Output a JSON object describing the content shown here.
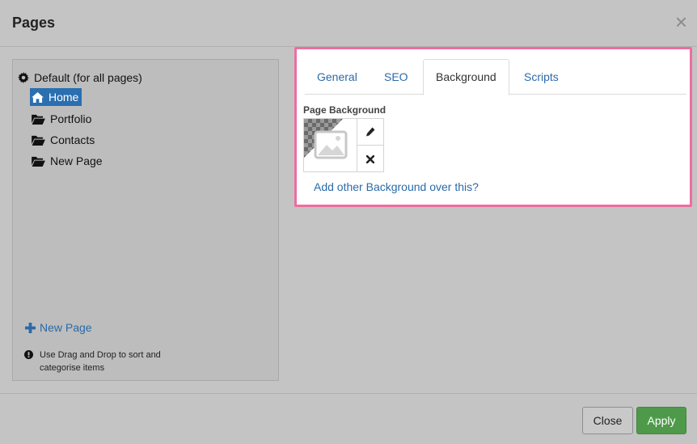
{
  "modal": {
    "title": "Pages",
    "close_icon": "close-icon"
  },
  "tree": {
    "root_label": "Default (for all pages)",
    "items": [
      {
        "label": "Home",
        "icon": "home-icon",
        "active": true
      },
      {
        "label": "Portfolio",
        "icon": "folder-open-icon",
        "active": false
      },
      {
        "label": "Contacts",
        "icon": "folder-open-icon",
        "active": false
      },
      {
        "label": "New Page",
        "icon": "folder-open-icon",
        "active": false
      }
    ],
    "new_page_label": "New Page",
    "hint": "Use Drag and Drop to sort and categorise items"
  },
  "tabs": [
    {
      "label": "General",
      "active": false
    },
    {
      "label": "SEO",
      "active": false
    },
    {
      "label": "Background",
      "active": true
    },
    {
      "label": "Scripts",
      "active": false
    }
  ],
  "background": {
    "label": "Page Background",
    "add_other_label": "Add other Background over this?"
  },
  "footer": {
    "close_label": "Close",
    "apply_label": "Apply"
  },
  "colors": {
    "accent": "#2a6fb0",
    "link": "#2b6aa8",
    "highlight_border": "#ee6da0",
    "apply": "#4e9a4a"
  }
}
